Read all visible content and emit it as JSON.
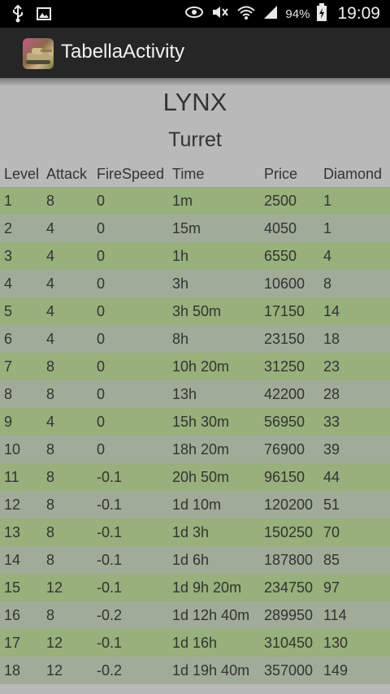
{
  "status_bar": {
    "battery": "94%",
    "time": "19:09",
    "icons": [
      "usb-icon",
      "image-icon",
      "eye-icon",
      "mute-icon",
      "wifi-icon",
      "signal-icon",
      "battery-icon"
    ]
  },
  "action_bar": {
    "title": "TabellaActivity"
  },
  "page": {
    "vehicle": "LYNX",
    "section": "Turret"
  },
  "table": {
    "headers": [
      "Level",
      "Attack",
      "FireSpeed",
      "Time",
      "Price",
      "Diamond"
    ],
    "rows": [
      [
        "1",
        "8",
        "0",
        "1m",
        "2500",
        "1"
      ],
      [
        "2",
        "4",
        "0",
        "15m",
        "4050",
        "1"
      ],
      [
        "3",
        "4",
        "0",
        "1h",
        "6550",
        "4"
      ],
      [
        "4",
        "4",
        "0",
        "3h",
        "10600",
        "8"
      ],
      [
        "5",
        "4",
        "0",
        "3h 50m",
        "17150",
        "14"
      ],
      [
        "6",
        "4",
        "0",
        "8h",
        "23150",
        "18"
      ],
      [
        "7",
        "8",
        "0",
        "10h 20m",
        "31250",
        "23"
      ],
      [
        "8",
        "8",
        "0",
        "13h",
        "42200",
        "28"
      ],
      [
        "9",
        "4",
        "0",
        "15h 30m",
        "56950",
        "33"
      ],
      [
        "10",
        "8",
        "0",
        "18h 20m",
        "76900",
        "39"
      ],
      [
        "11",
        "8",
        "-0.1",
        "20h 50m",
        "96150",
        "44"
      ],
      [
        "12",
        "8",
        "-0.1",
        "1d 10m",
        "120200",
        "51"
      ],
      [
        "13",
        "8",
        "-0.1",
        "1d 3h",
        "150250",
        "70"
      ],
      [
        "14",
        "8",
        "-0.1",
        "1d 6h",
        "187800",
        "85"
      ],
      [
        "15",
        "12",
        "-0.1",
        "1d 9h 20m",
        "234750",
        "97"
      ],
      [
        "16",
        "8",
        "-0.2",
        "1d 12h 40m",
        "289950",
        "114"
      ],
      [
        "17",
        "12",
        "-0.1",
        "1d 16h",
        "310450",
        "130"
      ],
      [
        "18",
        "12",
        "-0.2",
        "1d 19h 40m",
        "357000",
        "149"
      ]
    ]
  },
  "colors": {
    "row_light": "#97b07c",
    "row_dark": "#a1ac98",
    "background": "#b9b9b9"
  }
}
